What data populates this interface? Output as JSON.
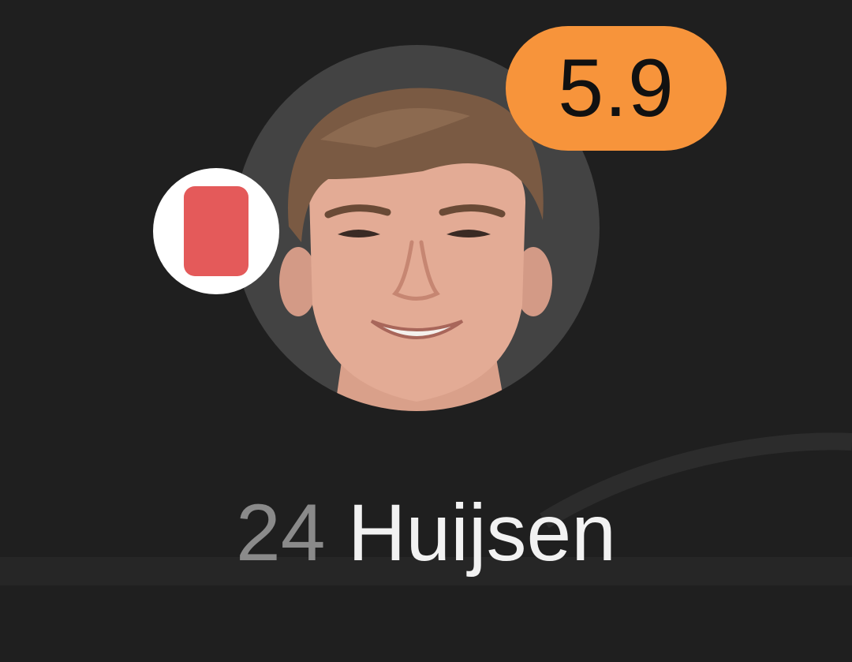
{
  "player": {
    "shirt_number": "24",
    "name": "Huijsen",
    "rating": "5.9",
    "card": "red-card-icon"
  },
  "colors": {
    "background": "#1f1f1f",
    "avatar_ring": "#434343",
    "rating_badge": "#f7943b",
    "red_card": "#e45a5a",
    "card_badge_bg": "#ffffff",
    "shirt_number_text": "#8a8a8a",
    "name_text": "#f2f2f2"
  }
}
